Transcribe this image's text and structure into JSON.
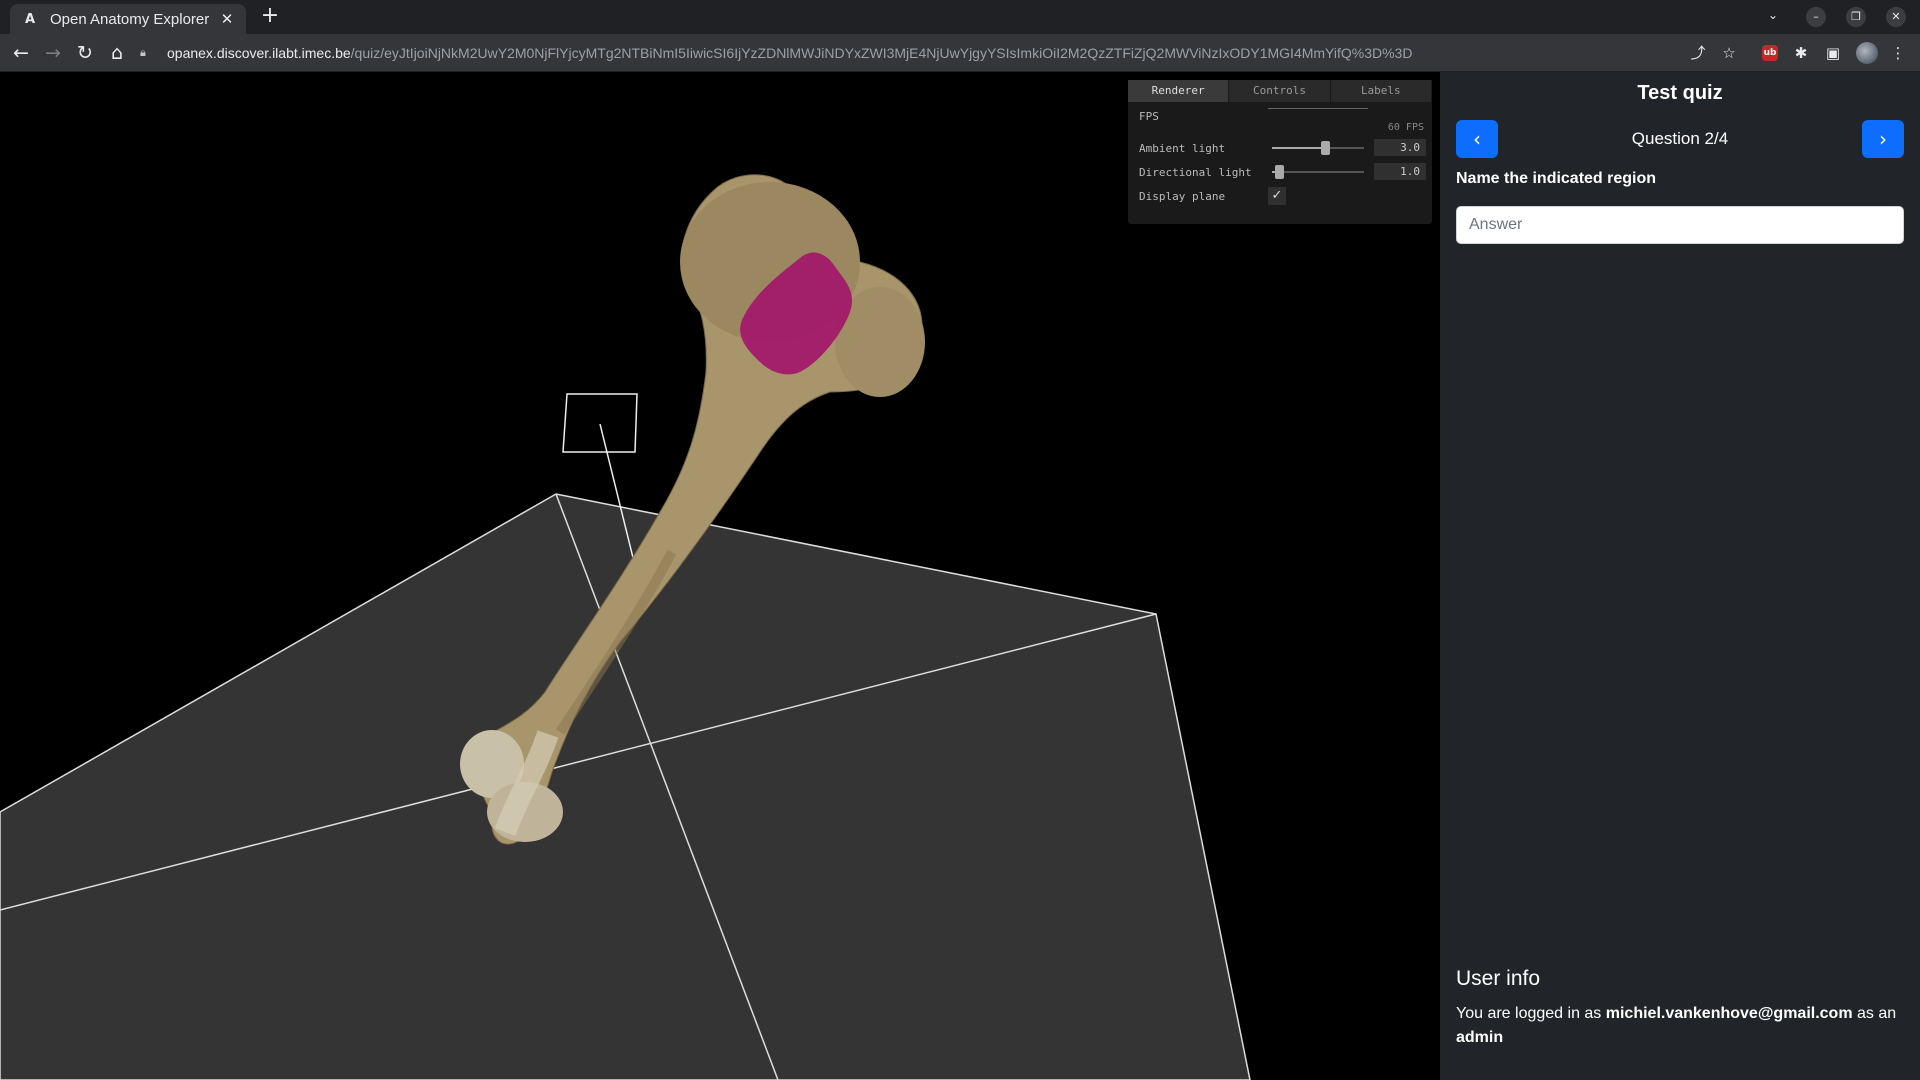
{
  "browser": {
    "tab_title": "Open Anatomy Explorer",
    "tab_favicon": "A",
    "url_host": "opanex.discover.ilabt.imec.be",
    "url_path": "/quiz/eyJtIjoiNjNkM2UwY2M0NjFlYjcyMTg2NTBiNmI5IiwicSI6IjYzZDNlMWJiNDYxZWI3MjE4NjUwYjgyYSIsImkiOiI2M2QzZTFiZjQ2MWViNzIxODY1MGI4MmYifQ%3D%3D"
  },
  "icons": {
    "back": "back-arrow-icon",
    "forward": "forward-arrow-icon",
    "reload": "reload-icon",
    "home": "home-icon",
    "lock": "lock-icon",
    "share": "share-icon",
    "bookmark": "star-icon",
    "extension": "puzzle-icon",
    "sidepanel": "side-panel-icon",
    "menu": "kebab-menu-icon"
  },
  "gui": {
    "tabs": [
      "Renderer",
      "Controls",
      "Labels"
    ],
    "fps_label": "FPS",
    "fps_value": "60 FPS",
    "ambient_label": "Ambient light",
    "ambient_value": "3.0",
    "ambient_fraction": 0.58,
    "directional_label": "Directional light",
    "directional_value": "1.0",
    "directional_fraction": 0.08,
    "display_plane_label": "Display plane",
    "display_plane_checked": true
  },
  "quiz": {
    "title": "Test quiz",
    "question_label": "Question 2/4",
    "prompt": "Name the indicated region",
    "answer_placeholder": "Answer",
    "answer_value": ""
  },
  "user": {
    "heading": "User info",
    "prefix": "You are logged in as ",
    "email": "michiel.vankenhove@gmail.com",
    "middle": " as an ",
    "role": "admin"
  },
  "colors": {
    "accent": "#0d6efd",
    "highlight_region": "#a3166a",
    "panel_bg": "#212529"
  }
}
